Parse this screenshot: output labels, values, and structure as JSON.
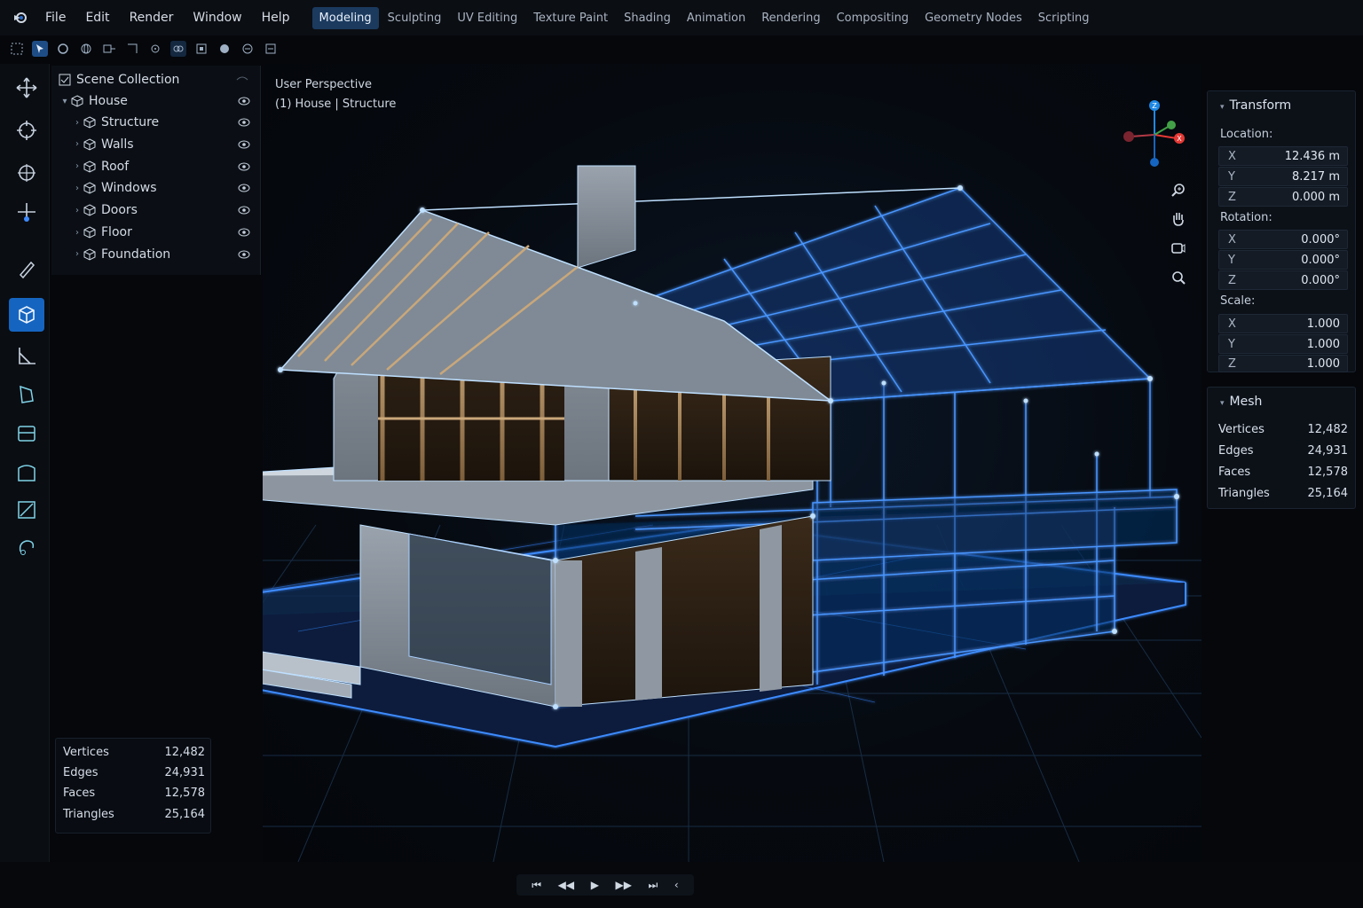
{
  "menu": [
    "File",
    "Edit",
    "Render",
    "Window",
    "Help"
  ],
  "workspaces": [
    {
      "label": "Modeling",
      "active": true
    },
    {
      "label": "Sculpting",
      "active": false
    },
    {
      "label": "UV Editing",
      "active": false
    },
    {
      "label": "Texture Paint",
      "active": false
    },
    {
      "label": "Shading",
      "active": false
    },
    {
      "label": "Animation",
      "active": false
    },
    {
      "label": "Rendering",
      "active": false
    },
    {
      "label": "Compositing",
      "active": false
    },
    {
      "label": "Geometry Nodes",
      "active": false
    },
    {
      "label": "Scripting",
      "active": false
    }
  ],
  "outliner": {
    "root": "Scene Collection",
    "collection": "House",
    "items": [
      "Structure",
      "Walls",
      "Roof",
      "Windows",
      "Doors",
      "Floor",
      "Foundation"
    ]
  },
  "viewport": {
    "view_name": "User Perspective",
    "context": "(1) House | Structure"
  },
  "transform": {
    "title": "Transform",
    "location_label": "Location:",
    "location": [
      {
        "axis": "X",
        "value": "12.436 m"
      },
      {
        "axis": "Y",
        "value": "8.217 m"
      },
      {
        "axis": "Z",
        "value": "0.000 m"
      }
    ],
    "rotation_label": "Rotation:",
    "rotation": [
      {
        "axis": "X",
        "value": "0.000°"
      },
      {
        "axis": "Y",
        "value": "0.000°"
      },
      {
        "axis": "Z",
        "value": "0.000°"
      }
    ],
    "scale_label": "Scale:",
    "scale": [
      {
        "axis": "X",
        "value": "1.000"
      },
      {
        "axis": "Y",
        "value": "1.000"
      },
      {
        "axis": "Z",
        "value": "1.000"
      }
    ]
  },
  "mesh": {
    "title": "Mesh",
    "stats": [
      {
        "label": "Vertices",
        "value": "12,482"
      },
      {
        "label": "Edges",
        "value": "24,931"
      },
      {
        "label": "Faces",
        "value": "12,578"
      },
      {
        "label": "Triangles",
        "value": "25,164"
      }
    ]
  },
  "overlay_stats": [
    {
      "label": "Vertices",
      "value": "12,482"
    },
    {
      "label": "Edges",
      "value": "24,931"
    },
    {
      "label": "Faces",
      "value": "12,578"
    },
    {
      "label": "Triangles",
      "value": "25,164"
    }
  ],
  "gizmo": {
    "x": "X",
    "y": "Y",
    "z": "Z"
  },
  "colors": {
    "accent": "#1565c0",
    "wire": "#3d8bff",
    "axis_x": "#e53935",
    "axis_y": "#43a047",
    "axis_z": "#1e88e5"
  },
  "icons": {
    "toolbar": [
      "move-icon",
      "cursor-icon",
      "rotate-icon",
      "transform-icon",
      "annotate-icon",
      "object-icon",
      "measure-icon",
      "extrude-icon",
      "inset-icon",
      "bevel-icon",
      "knife-icon",
      "spin-icon"
    ],
    "navigation": [
      "zoom-icon",
      "hand-icon",
      "camera-icon",
      "magnify-icon"
    ],
    "playback": [
      "jump-start-icon",
      "prev-keyframe-icon",
      "play-icon",
      "next-keyframe-icon",
      "jump-end-icon",
      "loop-icon"
    ]
  }
}
